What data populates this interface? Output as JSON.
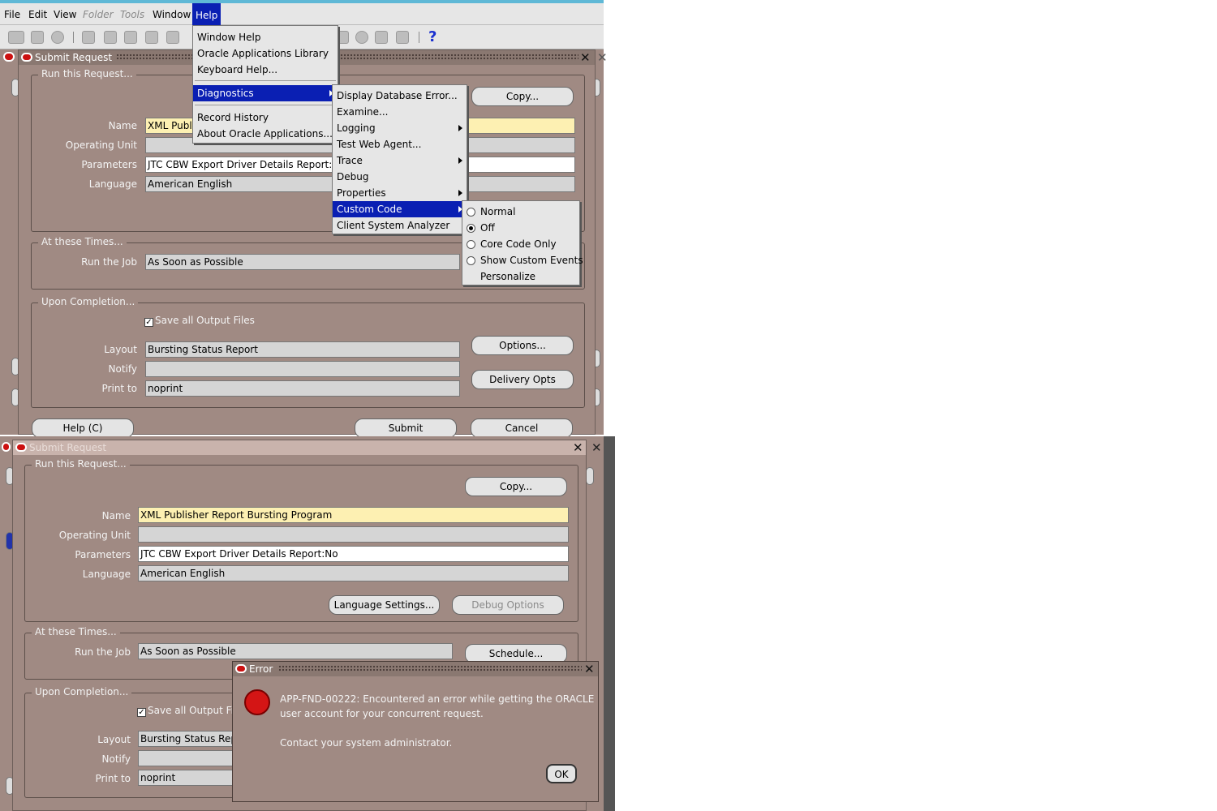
{
  "menubar": {
    "items": [
      "File",
      "Edit",
      "View",
      "Folder",
      "Tools",
      "Window",
      "Help"
    ]
  },
  "top_window": {
    "title": "Submit Request",
    "run_group": "Run this Request...",
    "copy_btn": "Copy...",
    "labels": {
      "name": "Name",
      "ou": "Operating Unit",
      "params": "Parameters",
      "lang": "Language"
    },
    "values": {
      "name": "XML Publi",
      "ou": "",
      "params": "JTC CBW Export Driver Details Report:N",
      "lang": "American English"
    },
    "times_group": "At these Times...",
    "run_job_label": "Run the Job",
    "run_job_value": "As Soon as Possible",
    "completion_group": "Upon Completion...",
    "save_output": "Save all Output Files",
    "layout_label": "Layout",
    "layout_value": "Bursting Status Report",
    "notify_label": "Notify",
    "notify_value": "",
    "printto_label": "Print to",
    "printto_value": "noprint",
    "options_btn": "Options...",
    "delivery_btn": "Delivery Opts",
    "help_btn": "Help (C)",
    "submit_btn": "Submit",
    "cancel_btn": "Cancel"
  },
  "help_menu": {
    "items": [
      "Window Help",
      "Oracle Applications Library",
      "Keyboard Help...",
      "Diagnostics",
      "Record History",
      "About Oracle Applications..."
    ]
  },
  "diagnostics_menu": {
    "items": [
      "Display Database Error...",
      "Examine...",
      "Logging",
      "Test Web Agent...",
      "Trace",
      "Debug",
      "Properties",
      "Custom Code",
      "Client System Analyzer"
    ]
  },
  "custom_code_menu": {
    "items": [
      "Normal",
      "Off",
      "Core Code Only",
      "Show Custom Events",
      "Personalize"
    ],
    "selected": "Off"
  },
  "bottom_window": {
    "title": "Submit Request",
    "run_group": "Run this Request...",
    "copy_btn": "Copy...",
    "labels": {
      "name": "Name",
      "ou": "Operating Unit",
      "params": "Parameters",
      "lang": "Language"
    },
    "values": {
      "name": "XML Publisher Report Bursting Program",
      "ou": "",
      "params": "JTC CBW Export Driver Details Report:No",
      "lang": "American English"
    },
    "lang_settings_btn": "Language Settings...",
    "debug_options_btn": "Debug Options",
    "times_group": "At these Times...",
    "run_job_label": "Run the Job",
    "run_job_value": "As Soon as Possible",
    "schedule_btn": "Schedule...",
    "completion_group": "Upon Completion...",
    "save_output": "Save all Output Fi",
    "layout_label": "Layout",
    "layout_value": "Bursting Status Rep",
    "notify_label": "Notify",
    "notify_value": "",
    "printto_label": "Print to",
    "printto_value": "noprint"
  },
  "error_dialog": {
    "title": "Error",
    "message1": "APP-FND-00222: Encountered an error while getting the ORACLE",
    "message2": "user account for your concurrent request.",
    "message3": "Contact your system administrator.",
    "ok_btn": "OK"
  }
}
